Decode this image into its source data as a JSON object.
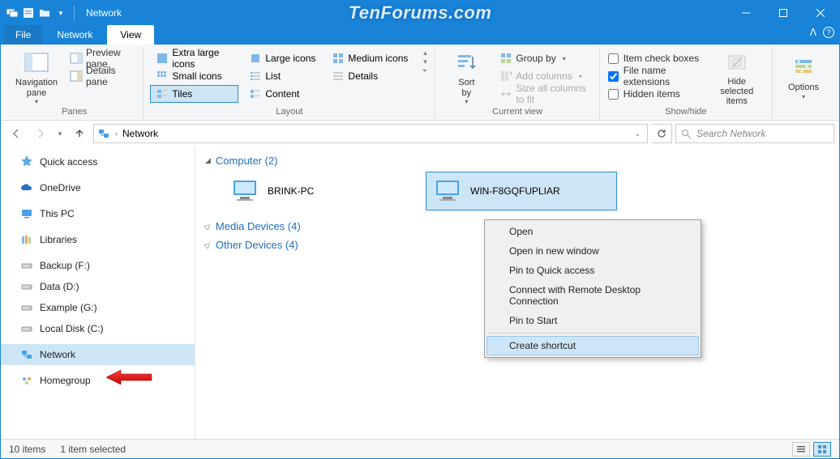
{
  "titlebar": {
    "title": "Network",
    "watermark": "TenForums.com"
  },
  "tabs": {
    "file": "File",
    "network": "Network",
    "view": "View"
  },
  "ribbon": {
    "panes": {
      "label": "Panes",
      "navigation": "Navigation\npane",
      "preview": "Preview pane",
      "details": "Details pane"
    },
    "layout": {
      "label": "Layout",
      "extra_large": "Extra large icons",
      "large": "Large icons",
      "medium": "Medium icons",
      "small": "Small icons",
      "list": "List",
      "details": "Details",
      "tiles": "Tiles",
      "content": "Content"
    },
    "current_view": {
      "label": "Current view",
      "sort_by": "Sort\nby",
      "group_by": "Group by",
      "add_columns": "Add columns",
      "size_all": "Size all columns to fit"
    },
    "show_hide": {
      "label": "Show/hide",
      "item_check": "Item check boxes",
      "file_ext": "File name extensions",
      "hidden": "Hidden items",
      "hide_selected": "Hide selected\nitems"
    },
    "options": "Options"
  },
  "address": {
    "location": "Network",
    "search_placeholder": "Search Network"
  },
  "sidebar": {
    "items": [
      {
        "label": "Quick access"
      },
      {
        "label": "OneDrive"
      },
      {
        "label": "This PC"
      },
      {
        "label": "Libraries"
      },
      {
        "label": "Backup (F:)"
      },
      {
        "label": "Data (D:)"
      },
      {
        "label": "Example (G:)"
      },
      {
        "label": "Local Disk (C:)"
      },
      {
        "label": "Network"
      },
      {
        "label": "Homegroup"
      }
    ]
  },
  "content": {
    "sections": {
      "computer": {
        "title": "Computer (2)",
        "expanded": true,
        "items": [
          "BRINK-PC",
          "WIN-F8GQFUPLIAR"
        ]
      },
      "media": {
        "title": "Media Devices (4)",
        "expanded": false
      },
      "other": {
        "title": "Other Devices (4)",
        "expanded": false
      }
    }
  },
  "context_menu": {
    "items": [
      "Open",
      "Open in new window",
      "Pin to Quick access",
      "Connect with Remote Desktop Connection",
      "Pin to Start",
      "Create shortcut"
    ],
    "highlighted_index": 5
  },
  "status": {
    "count": "10 items",
    "selected": "1 item selected"
  }
}
